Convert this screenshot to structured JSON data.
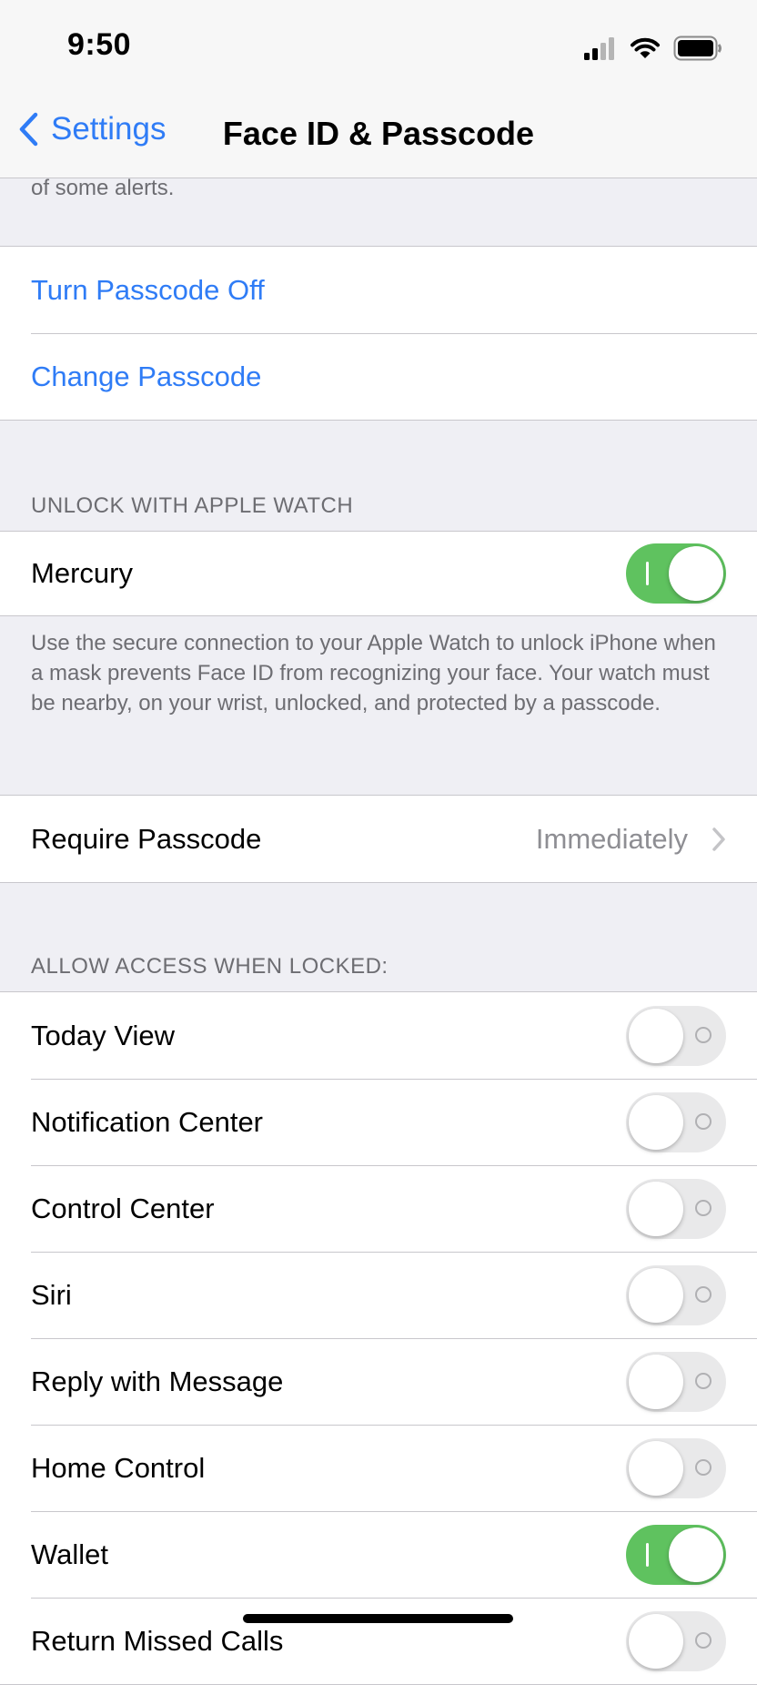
{
  "status_bar": {
    "time": "9:50"
  },
  "nav": {
    "back_label": "Settings",
    "title": "Face ID & Passcode"
  },
  "top_footer": "of some alerts.",
  "passcode_group": {
    "turn_off": "Turn Passcode Off",
    "change": "Change Passcode"
  },
  "apple_watch": {
    "header": "UNLOCK WITH APPLE WATCH",
    "device_label": "Mercury",
    "device_enabled": true,
    "footer": "Use the secure connection to your Apple Watch to unlock iPhone when a mask prevents Face ID from recognizing your face. Your watch must be nearby, on your wrist, unlocked, and protected by a passcode."
  },
  "require_passcode": {
    "label": "Require Passcode",
    "value": "Immediately"
  },
  "locked_access": {
    "header": "ALLOW ACCESS WHEN LOCKED:",
    "items": [
      {
        "label": "Today View",
        "enabled": false
      },
      {
        "label": "Notification Center",
        "enabled": false
      },
      {
        "label": "Control Center",
        "enabled": false
      },
      {
        "label": "Siri",
        "enabled": false
      },
      {
        "label": "Reply with Message",
        "enabled": false
      },
      {
        "label": "Home Control",
        "enabled": false
      },
      {
        "label": "Wallet",
        "enabled": true
      },
      {
        "label": "Return Missed Calls",
        "enabled": false
      }
    ]
  },
  "colors": {
    "accent": "#2f7cf6",
    "switch_on": "#5fc25f",
    "background": "#efeff4"
  }
}
